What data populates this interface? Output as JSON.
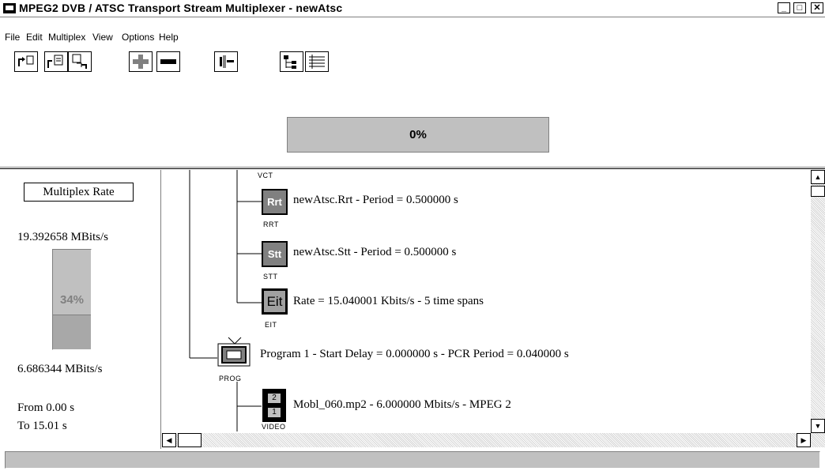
{
  "window": {
    "title": "MPEG2 DVB / ATSC Transport Stream Multiplexer - newAtsc",
    "minimize_label": "_",
    "maximize_label": "□",
    "close_label": "✕"
  },
  "menu": {
    "items": [
      "File",
      "Edit",
      "Multiplex",
      "View",
      "Options",
      "Help"
    ]
  },
  "toolbar": {
    "icons": [
      "new-icon",
      "open-icon",
      "save-icon",
      "add-icon",
      "remove-icon",
      "multiplex-icon",
      "tree-expand-icon",
      "tree-list-icon"
    ]
  },
  "progress": {
    "label": "0%",
    "value": 0
  },
  "left_panel": {
    "mux_rate_label": "Multiplex Rate",
    "max_rate": "19.392658 MBits/s",
    "gauge_label": "34%",
    "gauge_value": 0.34,
    "min_rate": "6.686344 MBits/s",
    "from_time": "From 0.00 s",
    "to_time": "To 15.01 s"
  },
  "tree": {
    "vct_caption": "VCT",
    "rrt": {
      "icon_text": "Rrt",
      "caption": "RRT",
      "label": "newAtsc.Rrt  -  Period = 0.500000 s"
    },
    "stt": {
      "icon_text": "Stt",
      "caption": "STT",
      "label": "newAtsc.Stt  -  Period = 0.500000 s"
    },
    "eit": {
      "icon_text": "Eit",
      "caption": "EIT",
      "label": "Rate = 15.040001 Kbits/s  -  5 time spans"
    },
    "program": {
      "caption": "PROG",
      "label": "Program 1  -  Start Delay = 0.000000 s  -  PCR Period = 0.040000 s"
    },
    "video": {
      "caption": "VIDEO",
      "frame_top": "2",
      "frame_bottom": "1",
      "label": "Mobl_060.mp2  -  6.000000 Mbits/s  -  MPEG 2"
    }
  },
  "status": {
    "text": ""
  },
  "colors": {
    "panel_gray": "#c0c0c0",
    "icon_dark": "#808080"
  }
}
